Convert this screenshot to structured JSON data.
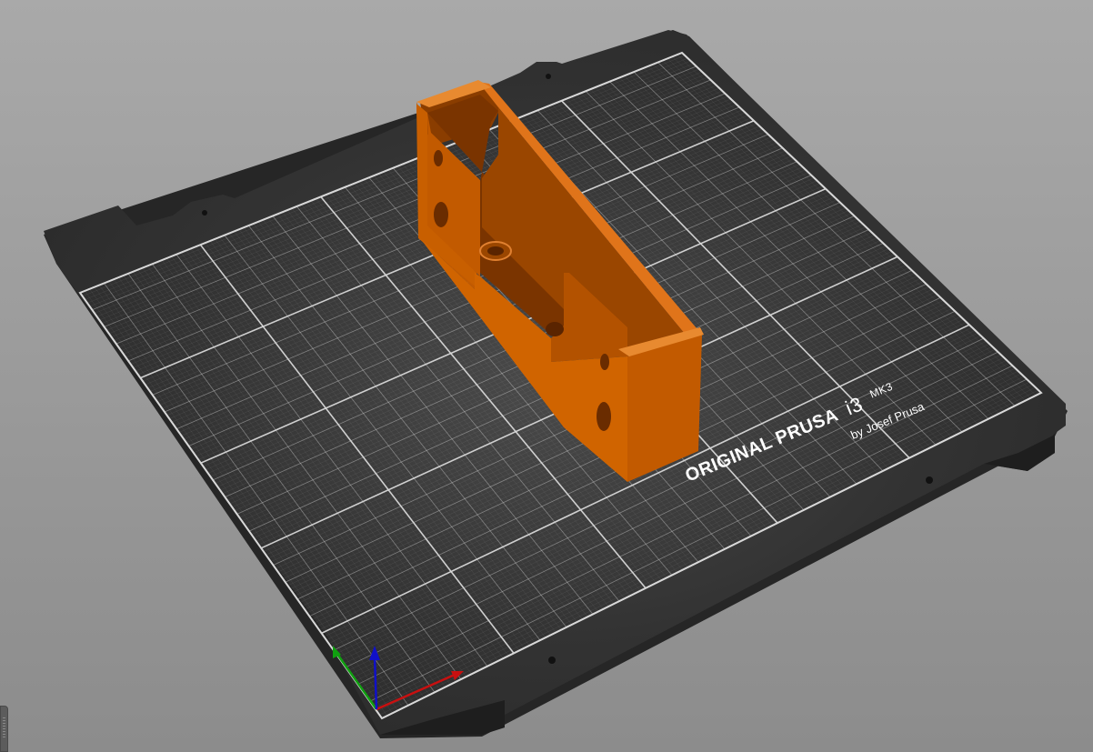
{
  "viewport": {
    "background_color": "#9e9e9e"
  },
  "bed": {
    "plate_color": "#2c2c2c",
    "grid_color": "#d8d8d8",
    "logo_line1": "ORIGINAL PRUSA",
    "logo_model": "i3",
    "logo_version": "MK3",
    "logo_line2": "by Josef Prusa"
  },
  "model": {
    "color": "#d96c00",
    "icon": "part-model"
  },
  "axes": {
    "x_color": "#c81010",
    "y_color": "#10a010",
    "z_color": "#1010c8"
  },
  "side_panel": {
    "icon": "collapse-handle"
  }
}
